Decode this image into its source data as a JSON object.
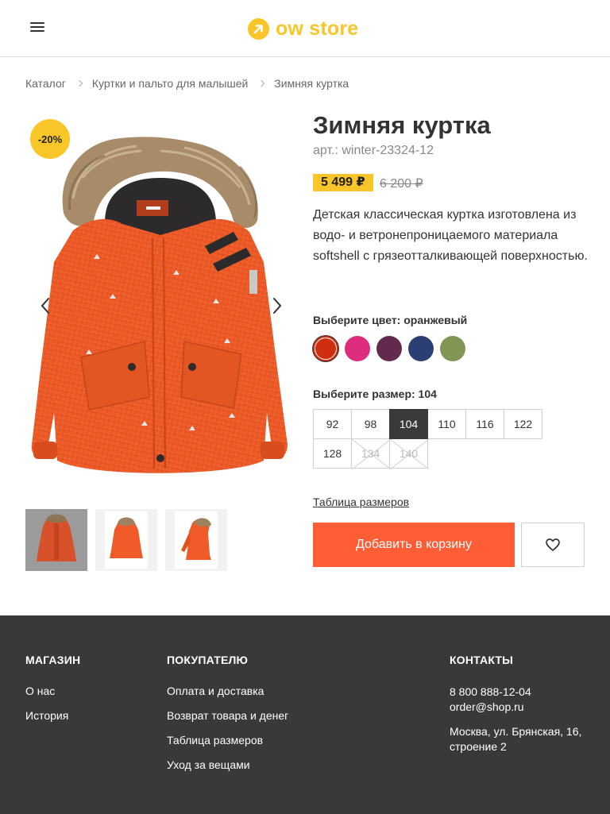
{
  "header": {
    "logo_text": "ow store"
  },
  "breadcrumbs": [
    "Каталог",
    "Куртки и пальто для малышей",
    "Зимняя куртка"
  ],
  "product": {
    "badge": "-20%",
    "title": "Зимняя куртка",
    "sku": "арт.: winter-23324-12",
    "price": "5 499 ₽",
    "old_price": "6 200 ₽",
    "description": "Детская классическая куртка изготовлена из водо- и ветронепроницаемого материала softshell с грязеотталкивающей поверхностью.",
    "color_label": "Выберите цвет: оранжевый",
    "colors": [
      {
        "name": "orange",
        "hex": "#cf2e0f",
        "selected": true
      },
      {
        "name": "pink",
        "hex": "#de2d7f",
        "selected": false
      },
      {
        "name": "plum",
        "hex": "#622b4d",
        "selected": false
      },
      {
        "name": "navy",
        "hex": "#2b3f75",
        "selected": false
      },
      {
        "name": "olive",
        "hex": "#819554",
        "selected": false
      }
    ],
    "size_label": "Выберите размер: 104",
    "sizes": [
      {
        "label": "92",
        "state": "available"
      },
      {
        "label": "98",
        "state": "available"
      },
      {
        "label": "104",
        "state": "selected"
      },
      {
        "label": "110",
        "state": "available"
      },
      {
        "label": "116",
        "state": "available"
      },
      {
        "label": "122",
        "state": "available"
      },
      {
        "label": "128",
        "state": "available"
      },
      {
        "label": "134",
        "state": "disabled"
      },
      {
        "label": "140",
        "state": "disabled"
      }
    ],
    "size_table_link": "Таблица размеров",
    "add_to_cart": "Добавить в корзину",
    "accent_color": "#fe5d36",
    "badge_color": "#f8c628"
  },
  "footer": {
    "shop": {
      "heading": "МАГАЗИН",
      "links": [
        "О нас",
        "История"
      ]
    },
    "customer": {
      "heading": "ПОКУПАТЕЛЮ",
      "links": [
        "Оплата и доставка",
        "Возврат товара и денег",
        "Таблица размеров",
        "Уход за вещами"
      ]
    },
    "contacts": {
      "heading": "КОНТАКТЫ",
      "phone": "8 800 888-12-04",
      "email": "order@shop.ru",
      "address": "Москва, ул. Брянская, 16, строение 2"
    }
  }
}
